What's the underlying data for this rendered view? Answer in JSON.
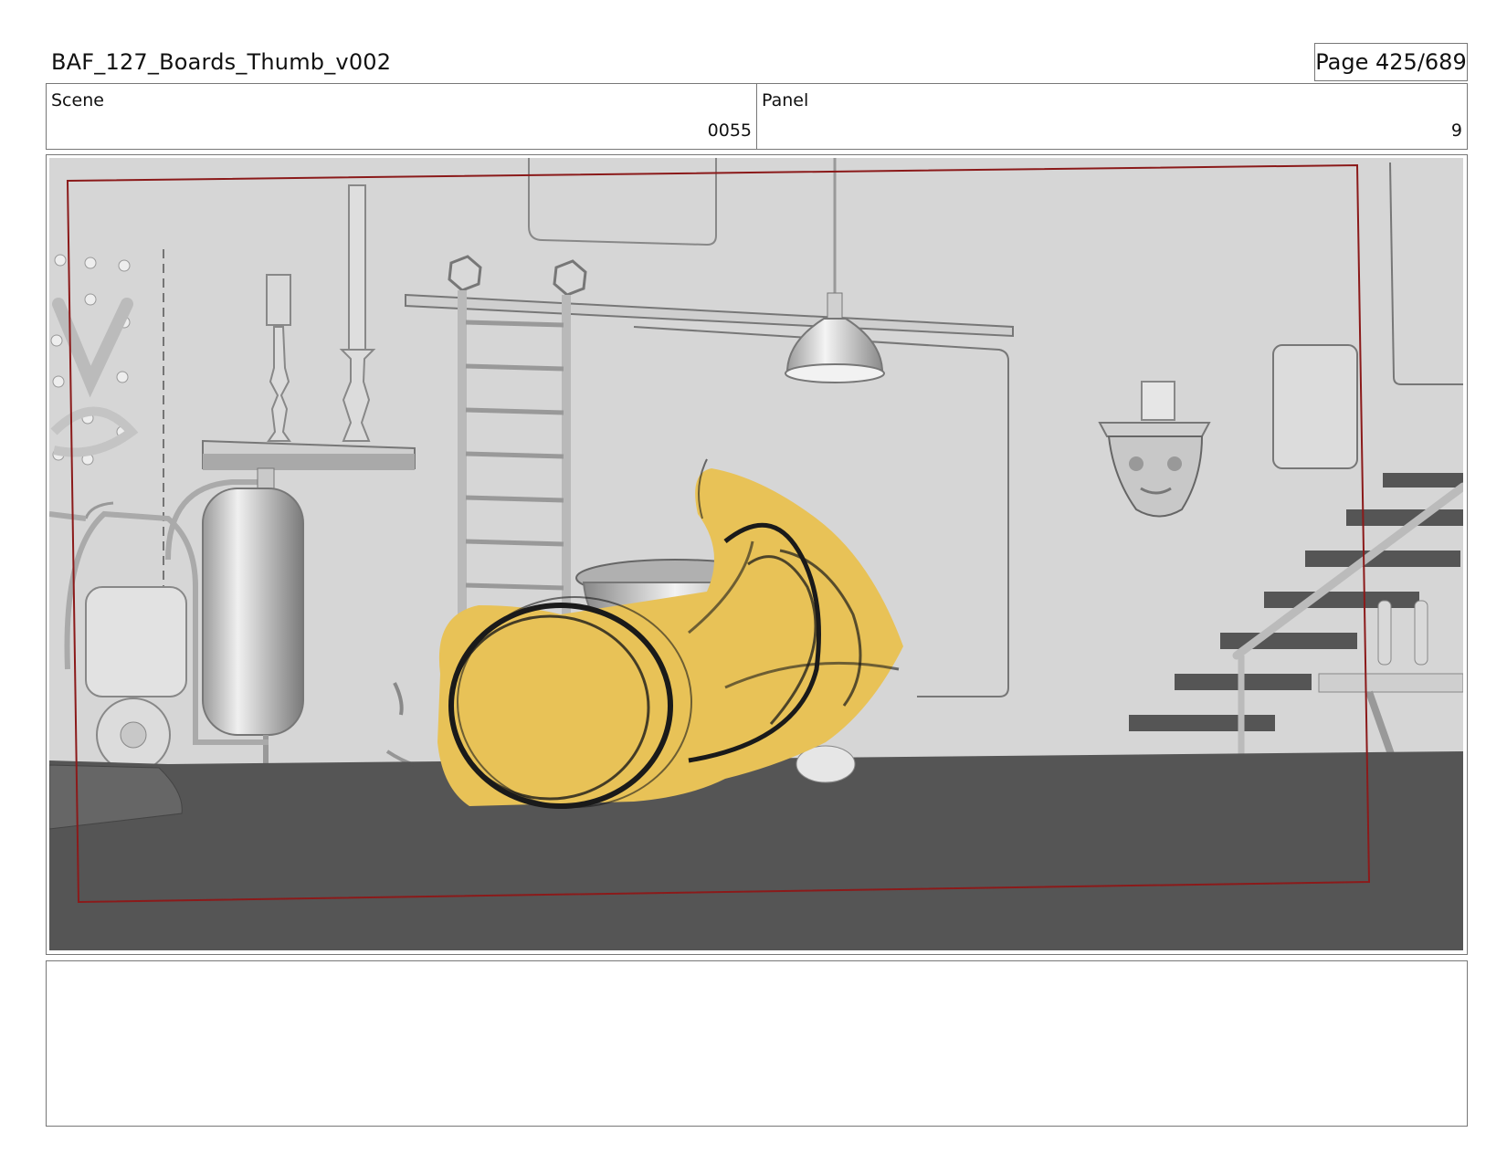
{
  "document": {
    "title": "BAF_127_Boards_Thumb_v002",
    "page_label": "Page 425/689"
  },
  "info": {
    "scene_label": "Scene",
    "scene_value": "0055",
    "panel_label": "Panel",
    "panel_value": "9"
  },
  "panel": {
    "colors": {
      "wall": "#d6d6d6",
      "floor": "#555555",
      "safe_frame": "#8b1a1a",
      "character_fill": "#e8c257",
      "sketch_line": "#1a1a1a"
    }
  },
  "notes": {
    "text": ""
  }
}
